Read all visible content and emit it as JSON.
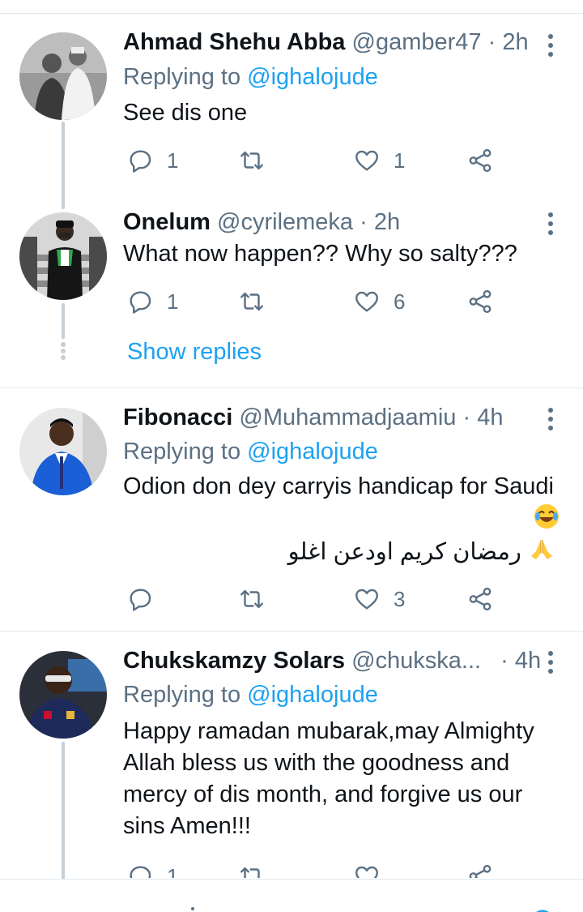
{
  "tweets": [
    {
      "name": "Ahmad Shehu Abba",
      "handle": "@gamber47",
      "dot": "·",
      "time": "2h",
      "replying_prefix": "Replying to",
      "replying_to": "@ighalojude",
      "text": "See dis one",
      "reply_count": "1",
      "retweet_count": "",
      "like_count": "1"
    },
    {
      "name": "Onelum",
      "handle": "@cyrilemeka",
      "dot": "·",
      "time": "2h",
      "text": "What now happen?? Why so salty???",
      "reply_count": "1",
      "retweet_count": "",
      "like_count": "6",
      "show_replies": "Show replies"
    },
    {
      "name": "Fibonacci",
      "handle": "@Muhammadjaamiu",
      "dot": "·",
      "time": "4h",
      "replying_prefix": "Replying to",
      "replying_to": "@ighalojude",
      "text_line1": "Odion don dey carryis handicap for Saudi",
      "emoji_laugh": "😂",
      "text_arabic": "رمضان كريم اودعن اغلو",
      "emoji_pray": "🙏",
      "reply_count": "",
      "retweet_count": "",
      "like_count": "3"
    },
    {
      "name": "Chukskamzy Solars",
      "handle": "@chukska...",
      "dot": "·",
      "time": "4h",
      "replying_prefix": "Replying to",
      "replying_to": "@ighalojude",
      "text_lines": [
        "Happy ramadan mubarak,may Almighty",
        "Allah bless us with the goodness and",
        "mercy of dis month, and forgive us our",
        "sins Amen!!!"
      ],
      "reply_count": "1",
      "retweet_count": "",
      "like_count": ""
    }
  ],
  "colors": {
    "accent": "#1da1f2",
    "muted": "#5b7083",
    "text": "#0f1419",
    "thread": "#c4cfd6",
    "divider": "#e1e8ed"
  },
  "icons": [
    "reply-icon",
    "retweet-icon",
    "like-icon",
    "share-icon",
    "more-icon"
  ]
}
